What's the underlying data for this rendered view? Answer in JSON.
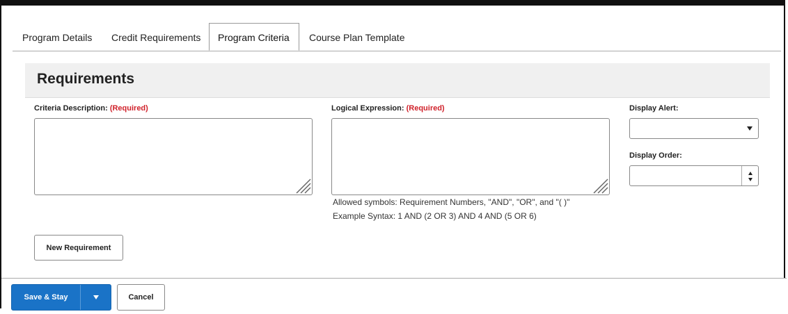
{
  "tabs": [
    {
      "label": "Program Details",
      "active": false
    },
    {
      "label": "Credit Requirements",
      "active": false
    },
    {
      "label": "Program Criteria",
      "active": true
    },
    {
      "label": "Course Plan Template",
      "active": false
    }
  ],
  "section": {
    "title": "Requirements"
  },
  "form": {
    "criteria_description": {
      "label": "Criteria Description:",
      "required": "(Required)",
      "value": ""
    },
    "logical_expression": {
      "label": "Logical Expression:",
      "required": "(Required)",
      "value": "",
      "hint_symbols": "Allowed symbols: Requirement Numbers, \"AND\", \"OR\", and \"( )\"",
      "hint_example": "Example Syntax: 1 AND (2 OR 3) AND 4 AND (5 OR 6)"
    },
    "display_alert": {
      "label": "Display Alert:",
      "value": ""
    },
    "display_order": {
      "label": "Display Order:",
      "value": ""
    },
    "new_requirement_label": "New Requirement"
  },
  "footer": {
    "save_stay_label": "Save & Stay",
    "cancel_label": "Cancel"
  },
  "colors": {
    "primary": "#1a73c7",
    "required": "#d0212a"
  },
  "icons": {
    "select_caret": "chevron-down-icon",
    "stepper": "stepper-arrows-icon",
    "resize": "resize-grip-icon"
  }
}
